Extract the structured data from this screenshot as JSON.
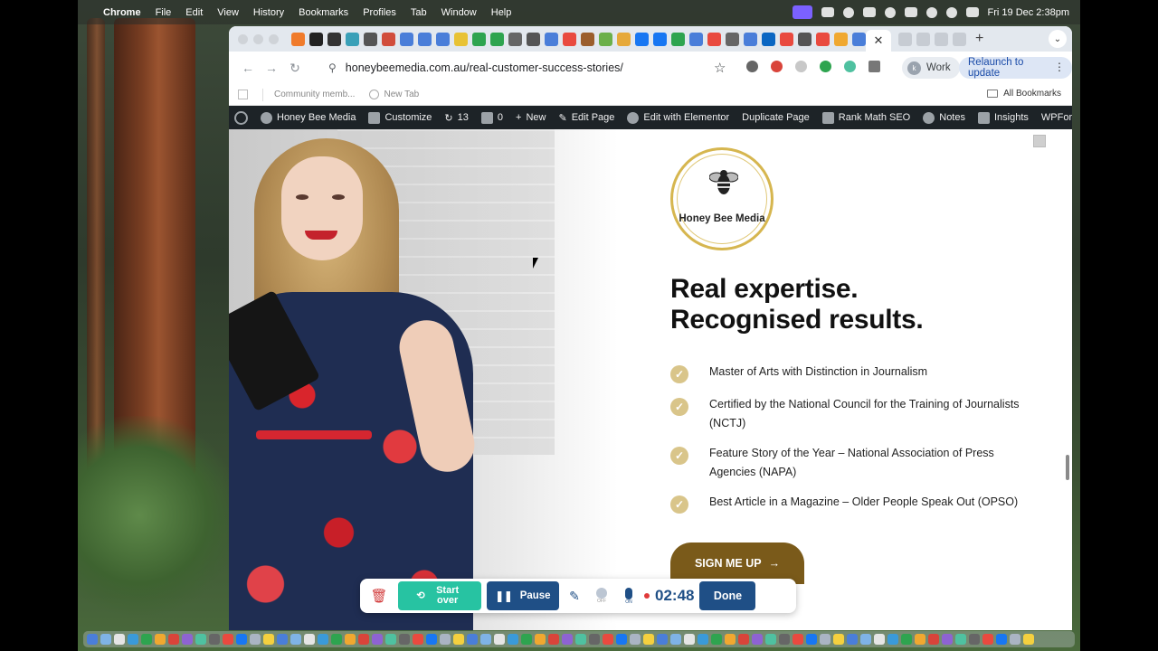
{
  "menubar": {
    "app": "Chrome",
    "items": [
      "File",
      "Edit",
      "View",
      "History",
      "Bookmarks",
      "Profiles",
      "Tab",
      "Window",
      "Help"
    ],
    "clock": "Fri 19 Dec  2:38pm"
  },
  "browser": {
    "url": "honeybeemedia.com.au/real-customer-success-stories/",
    "profile_chip": "Work",
    "profile_initial": "k",
    "relaunch": "Relaunch to update",
    "active_tab_close": "✕",
    "new_tab": "+",
    "bookmarks": [
      "Community memb...",
      "New Tab"
    ],
    "all_bookmarks": "All Bookmarks"
  },
  "wpbar": {
    "site": "Honey Bee Media",
    "customize": "Customize",
    "updates": "13",
    "comments": "0",
    "new": "New",
    "edit_page": "Edit Page",
    "elementor": "Edit with Elementor",
    "duplicate": "Duplicate Page",
    "rankmath": "Rank Math SEO",
    "notes": "Notes",
    "insights": "Insights",
    "wpforms": "WPForms"
  },
  "page": {
    "logo_text": "Honey Bee Media",
    "headline_line1": "Real expertise.",
    "headline_line2": "Recognised results.",
    "credentials": [
      "Master of Arts with Distinction in Journalism",
      "Certified by the National Council for the Training of Journalists (NCTJ)",
      "Feature Story of the Year – National Association of Press Agencies (NAPA)",
      "Best Article in a Magazine – Older People Speak Out (OPSO)"
    ],
    "cta": "SIGN ME UP",
    "cta_arrow": "→"
  },
  "recorder": {
    "start_over": "Start over",
    "pause": "Pause",
    "cam_state": "OFF",
    "mic_state": "ON",
    "timer": "02:48",
    "done": "Done"
  },
  "colors": {
    "cta_bg": "#7a5a1a",
    "check": "#d9c58a",
    "recorder_blue": "#1f4f86",
    "recorder_green": "#27c3a2",
    "wp_admin": "#1d2327"
  }
}
